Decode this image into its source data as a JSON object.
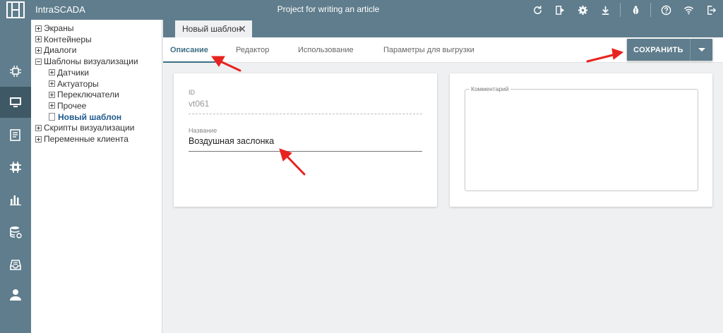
{
  "app": {
    "title": "IntraSCADA",
    "project": "Project for writing an article"
  },
  "topbar_icons": [
    "refresh-icon",
    "run-icon",
    "settings-icon",
    "download-icon",
    "bug-icon",
    "help-icon",
    "wifi-icon",
    "exit-icon"
  ],
  "rail_items": [
    "hardware-icon",
    "screen-icon",
    "document-icon",
    "chip-icon",
    "chart-icon",
    "database-icon",
    "archive-icon",
    "user-icon"
  ],
  "tree": {
    "items": [
      {
        "label": "Экраны",
        "level": 0,
        "kind": "plus"
      },
      {
        "label": "Контейнеры",
        "level": 0,
        "kind": "plus"
      },
      {
        "label": "Диалоги",
        "level": 0,
        "kind": "plus"
      },
      {
        "label": "Шаблоны визуализации",
        "level": 0,
        "kind": "minus"
      },
      {
        "label": "Датчики",
        "level": 1,
        "kind": "plus"
      },
      {
        "label": "Актуаторы",
        "level": 1,
        "kind": "plus"
      },
      {
        "label": "Переключатели",
        "level": 1,
        "kind": "plus"
      },
      {
        "label": "Прочее",
        "level": 1,
        "kind": "plus"
      },
      {
        "label": "Новый шаблон",
        "level": 1,
        "kind": "doc",
        "selected": true
      },
      {
        "label": "Скрипты визуализации",
        "level": 0,
        "kind": "plus"
      },
      {
        "label": "Переменные клиента",
        "level": 0,
        "kind": "plus"
      }
    ]
  },
  "editor_tab": {
    "label": "Новый шаблон",
    "close": "✕"
  },
  "subtabs": [
    {
      "label": "Описание",
      "active": true
    },
    {
      "label": "Редактор"
    },
    {
      "label": "Использование"
    },
    {
      "label": "Параметры для выгрузки"
    }
  ],
  "save_button": {
    "label": "СОХРАНИТЬ"
  },
  "form": {
    "id_label": "ID",
    "id_value": "vt061",
    "name_label": "Название",
    "name_value": "Воздушная заслонка",
    "comment_label": "Комментарий",
    "comment_value": ""
  },
  "colors": {
    "primary": "#5f7d8c",
    "accent": "#3e6f85",
    "annotation": "#e8231f"
  }
}
